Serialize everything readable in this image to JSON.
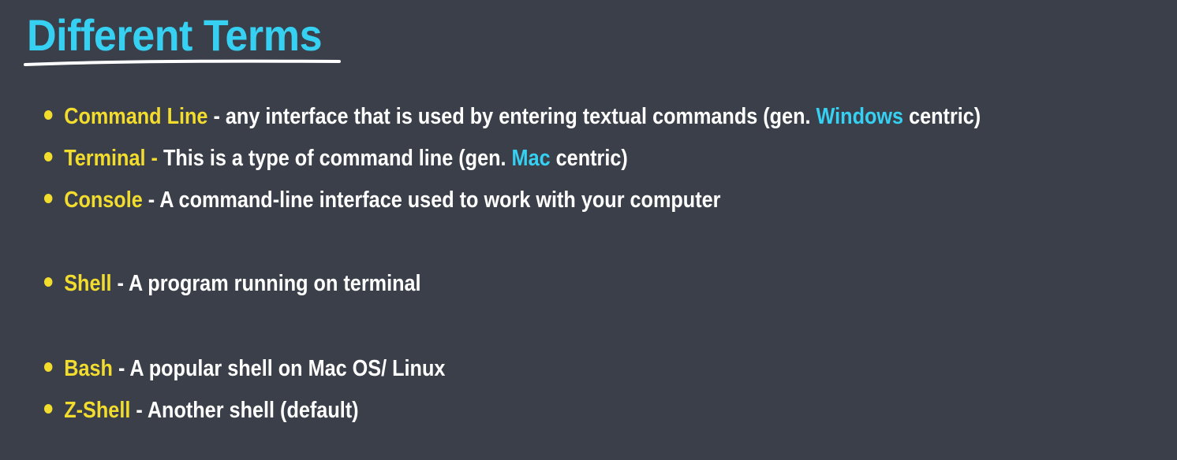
{
  "title": "Different Terms",
  "colors": {
    "background": "#3a3f4a",
    "title": "#36d1f2",
    "term": "#f2dc2e",
    "highlight": "#36d1f2",
    "text": "#ffffff"
  },
  "items": [
    {
      "term": "Command Line",
      "text_before": " - any interface that is used by entering textual commands (gen. ",
      "highlight": "Windows",
      "text_after": " centric)"
    },
    {
      "term": "Terminal -",
      "text_before": " This is a type of command line  (gen. ",
      "highlight": "Mac",
      "text_after": " centric)"
    },
    {
      "term": "Console",
      "text_before": " - A command-line interface used to work with your computer"
    },
    {
      "term": "Shell",
      "text_before": " - A program running on terminal"
    },
    {
      "term": "Bash",
      "text_before": " - A popular shell on Mac OS/ Linux"
    },
    {
      "term": "Z-Shell",
      "text_before": " - Another shell (default)"
    }
  ]
}
